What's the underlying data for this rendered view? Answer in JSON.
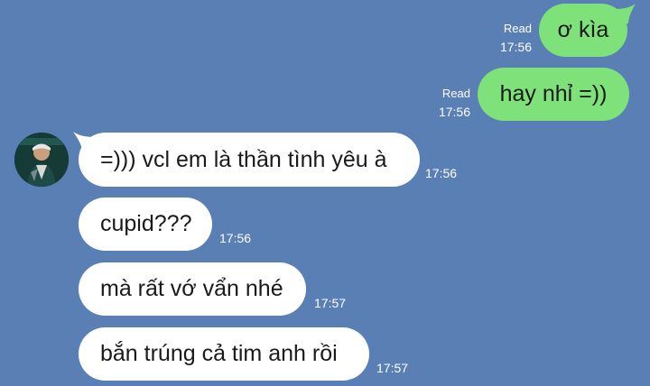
{
  "conversation": {
    "outgoing": [
      {
        "text": "ơ kìa",
        "status": "Read",
        "time": "17:56"
      },
      {
        "text": "hay nhỉ =))",
        "status": "Read",
        "time": "17:56"
      }
    ],
    "incoming": [
      {
        "text": "=))) vcl em là thần tình yêu à",
        "time": "17:56"
      },
      {
        "text": "cupid???",
        "time": "17:56"
      },
      {
        "text": "mà rất vớ vẩn nhé",
        "time": "17:57"
      },
      {
        "text": "bắn trúng cả tim anh rồi",
        "time": "17:57"
      }
    ]
  },
  "colors": {
    "background": "#5a7fb4",
    "outgoing_bubble": "#7fe179",
    "incoming_bubble": "#ffffff"
  },
  "icons": {
    "avatar": "contact-avatar-photo"
  }
}
